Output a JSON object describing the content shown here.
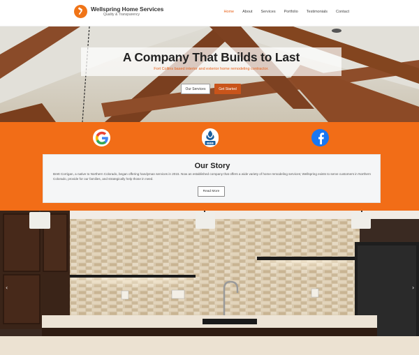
{
  "brand": {
    "name": "Wellspring Home Services",
    "tagline": "Quality & Transparency"
  },
  "nav": {
    "items": [
      {
        "label": "Home",
        "active": true
      },
      {
        "label": "About"
      },
      {
        "label": "Services"
      },
      {
        "label": "Portfolio"
      },
      {
        "label": "Testimonials"
      },
      {
        "label": "Contact"
      }
    ]
  },
  "hero": {
    "title": "A Company That Builds to Last",
    "subtitle": "Fort Collins based interior and exterior home remodeling contractor.",
    "services_button": "Our Services",
    "started_button": "Get Started"
  },
  "social": {
    "google_icon": "google-icon",
    "bbb_icon": "bbb-icon",
    "bbb_text": "BBB",
    "facebook_icon": "facebook-icon"
  },
  "story": {
    "title": "Our Story",
    "text": "Brett Corrigan, a native to Northern Colorado, began offering handyman services in 2015. Now an established company that offers a wide variety of home remodeling services; Wellspring exists to serve customers in Northern Colorado, provide for our families, and strategically help those in need.",
    "read_more": "Read More"
  },
  "carousel": {
    "prev": "‹",
    "next": "›"
  },
  "colors": {
    "accent": "#f26d17",
    "button": "#c9541a",
    "facebook": "#1877f2"
  }
}
